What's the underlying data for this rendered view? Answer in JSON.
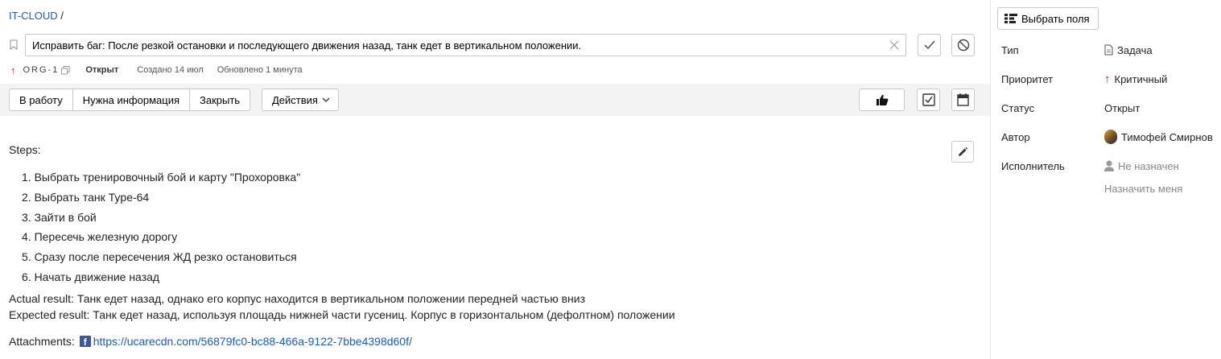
{
  "breadcrumb": {
    "project": "IT-CLOUD",
    "separator": "/"
  },
  "issue": {
    "title": "Исправить баг: После резкой остановки и последующего движения назад, танк едет в вертикальном положении.",
    "key": "ORG-1",
    "status": "Открыт",
    "created": "Создано 14 июл",
    "updated": "Обновлено 1 минута",
    "priority_color": "#e02020"
  },
  "toolbar": {
    "workflow_buttons": [
      "В работу",
      "Нужна информация",
      "Закрыть"
    ],
    "actions_label": "Действия"
  },
  "description": {
    "heading": "Steps:",
    "steps": [
      "1. Выбрать тренировочный бой и карту \"Прохоровка\"",
      "2. Выбрать танк Type-64",
      "3. Зайти в бой",
      "4. Пересечь железную дорогу",
      "5. Сразу после пересечения ЖД резко остановиться",
      "6. Начать движение назад"
    ],
    "actual": "Actual result: Танк едет назад, однако его корпус находится в вертикальном положении передней частью вниз",
    "expected": "Expected result: Танк едет назад, используя площадь нижней части гусениц. Корпус в горизонтальном (дефолтном) положении",
    "attachments_label": "Attachments:",
    "attachment_url": "https://ucarecdn.com/56879fc0-bc88-466a-9122-7bbe4398d60f/"
  },
  "sidebar": {
    "select_fields_label": "Выбрать поля",
    "fields": [
      {
        "label": "Тип",
        "value": "Задача",
        "icon": "document-icon"
      },
      {
        "label": "Приоритет",
        "value": "Критичный",
        "icon": "arrow-up-icon"
      },
      {
        "label": "Статус",
        "value": "Открыт"
      },
      {
        "label": "Автор",
        "value": "Тимофей Смирнов",
        "icon": "avatar"
      },
      {
        "label": "Исполнитель",
        "value": "Не назначен",
        "icon": "person-icon"
      }
    ],
    "assign_me": "Назначить меня"
  },
  "colors": {
    "link": "#1a5bbf",
    "toolbar_bg": "#f3f3f3",
    "border": "#c8c8c8"
  }
}
